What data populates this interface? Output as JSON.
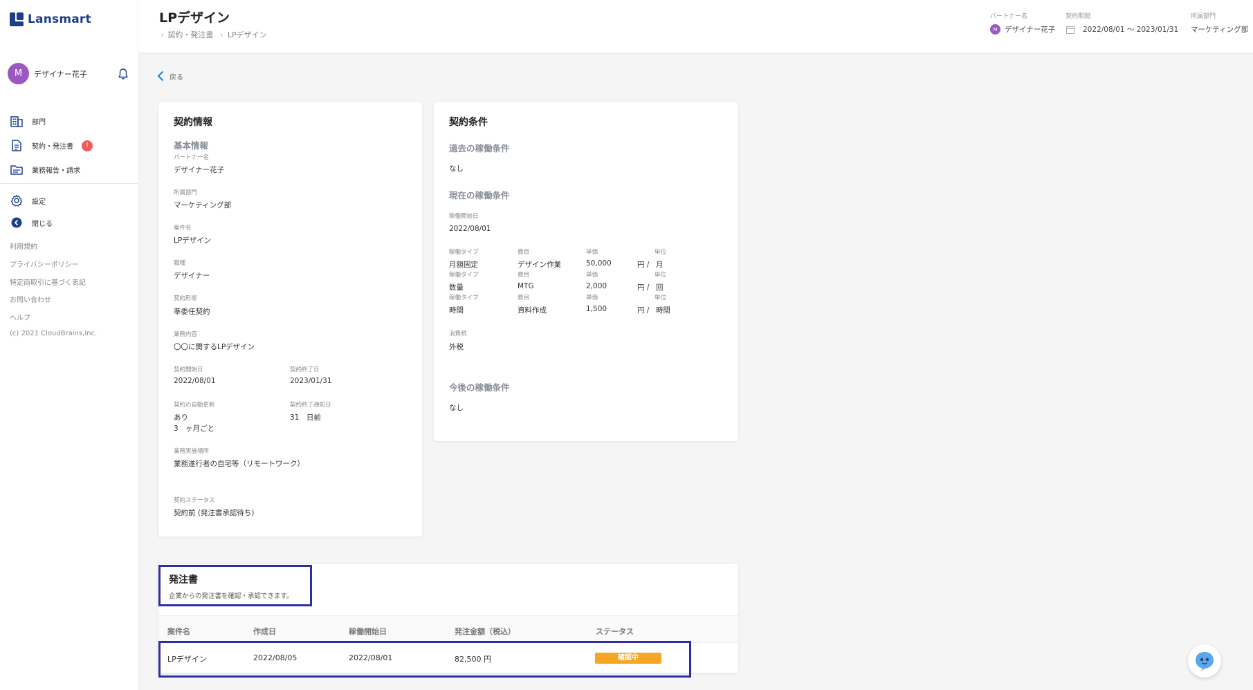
{
  "app": {
    "logo_text": "Lansmart",
    "user_initial": "M",
    "user_name": "デザイナー花子"
  },
  "sidebar": {
    "menu": [
      {
        "label": "部門",
        "icon": "building-icon"
      },
      {
        "label": "契約・発注書",
        "icon": "document-icon",
        "badge": "!"
      },
      {
        "label": "業務報告・請求",
        "icon": "folder-icon"
      }
    ],
    "menu2": [
      {
        "label": "設定",
        "icon": "gear-icon"
      },
      {
        "label": "閉じる",
        "icon": "collapse-icon"
      }
    ],
    "links": [
      "利用規約",
      "プライバシーポリシー",
      "特定商取引に基づく表記",
      "お問い合わせ",
      "ヘルプ",
      "(c) 2021 CloudBrains,Inc."
    ]
  },
  "header": {
    "title": "LPデザイン",
    "breadcrumb": [
      "契約・発注書",
      "LPデザイン"
    ],
    "partner_label": "パートナー名",
    "partner_initial": "M",
    "partner_value": "デザイナー花子",
    "period_label": "契約期間",
    "period_value": "2022/08/01 〜 2023/01/31",
    "dept_label": "所属部門",
    "dept_value": "マーケティング部"
  },
  "back_label": "戻る",
  "contract_info": {
    "title": "契約情報",
    "section": "基本情報",
    "partner_label": "パートナー名",
    "partner_value": "デザイナー花子",
    "dept_label": "所属部門",
    "dept_value": "マーケティング部",
    "project_label": "案件名",
    "project_value": "LPデザイン",
    "job_label": "職種",
    "job_value": "デザイナー",
    "form_label": "契約形態",
    "form_value": "準委任契約",
    "content_label": "業務内容",
    "content_value": "〇〇に関するLPデザイン",
    "start_label": "契約開始日",
    "start_value": "2022/08/01",
    "end_label": "契約終了日",
    "end_value": "2023/01/31",
    "renew_label": "契約の自動更新",
    "renew_value": "あり",
    "renew_period": "3　ヶ月ごと",
    "notice_label": "契約終了通知日",
    "notice_value": "31　日前",
    "place_label": "業務実施場所",
    "place_value": "業務遂行者の自宅等（リモートワーク）",
    "status_label": "契約ステータス",
    "status_value": "契約前 (発注書承認待ち)"
  },
  "terms": {
    "title": "契約条件",
    "past_heading": "過去の稼働条件",
    "past_value": "なし",
    "current_heading": "現在の稼働条件",
    "start_label": "稼働開始日",
    "start_value": "2022/08/01",
    "col_type": "稼働タイプ",
    "col_item": "費目",
    "col_price": "単価",
    "col_unit": "単位",
    "rows": [
      {
        "type": "月額固定",
        "item": "デザイン作業",
        "price": "50,000",
        "yen": "円 /",
        "unit": "月"
      },
      {
        "type": "数量",
        "item": "MTG",
        "price": "2,000",
        "yen": "円 /",
        "unit": "回"
      },
      {
        "type": "時間",
        "item": "資料作成",
        "price": "1,500",
        "yen": "円 /",
        "unit": "時間"
      }
    ],
    "tax_label": "消費税",
    "tax_value": "外税",
    "future_heading": "今後の稼働条件",
    "future_value": "なし"
  },
  "orders": {
    "title": "発注書",
    "subtitle": "企業からの発注書を確認・承認できます。",
    "columns": [
      "案件名",
      "作成日",
      "稼働開始日",
      "発注金額（税込）",
      "ステータス"
    ],
    "row": {
      "name": "LPデザイン",
      "created": "2022/08/05",
      "start": "2022/08/01",
      "amount": "82,500 円",
      "status": "確認中"
    }
  },
  "colors": {
    "brand": "#1d3f8a",
    "avatar": "#9c58c2",
    "badge": "#ef5a5a",
    "status_pending": "#f5a623",
    "highlight": "#2d2faa"
  }
}
